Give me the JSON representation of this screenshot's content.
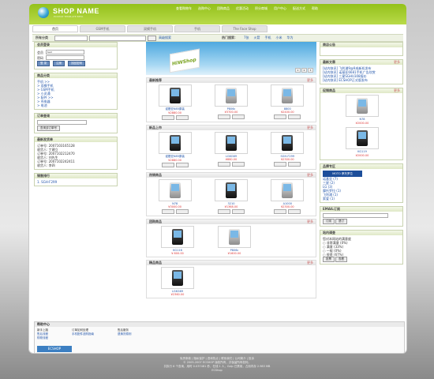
{
  "header": {
    "brand": "SHOP NAME",
    "tagline": "ECSHOP TEMPLATE BETA"
  },
  "topnav": [
    "查看购物车",
    "选购中心",
    "团购商品",
    "优惠活动",
    "积分商城",
    "用户中心",
    "配送方式",
    "帮助"
  ],
  "tabs": [
    "首页",
    "GSM手机",
    "双模手机",
    "手机",
    "The Face Shop"
  ],
  "searchbar": {
    "label": "所有分类",
    "button": "搜索",
    "advanced": "高级搜索",
    "hot_label": "热门搜索：",
    "hot_links": [
      "7张",
      "火箭",
      "手机",
      "小米",
      "华为"
    ]
  },
  "left": {
    "member": {
      "title": "会员登录",
      "user_label": "会员",
      "pass_label": "密码",
      "user_value": "test",
      "buttons": [
        "登 录",
        "注册",
        "找回密码"
      ]
    },
    "categories": {
      "title": "商品分类",
      "items": [
        "手机 >>",
        "> 双模手机",
        "> GSM手机",
        "> 小灵通",
        "> 配件 >>",
        "> 充电器",
        "> 电池"
      ]
    },
    "order": {
      "title": "订单查询",
      "button": "查询该订单号"
    },
    "invoice": {
      "title": "最新发货单",
      "rows": [
        "订单号: 2007103165128",
        "收货人: 丁建立",
        "订单号: 2007102212470",
        "收货人: 刘先生",
        "订单号: 2007102242411",
        "收货人: 李四"
      ]
    },
    "top10": {
      "title": "销售排行",
      "items": [
        "1. SGH-F299"
      ]
    }
  },
  "main": {
    "banner_text": "HiWShop",
    "banner_pages": [
      "1",
      "2",
      "3"
    ],
    "sections": [
      {
        "title": "最新推荐",
        "more": "更多",
        "products": [
          {
            "name": "诺基亚N85原装",
            "price": "¥2880.00"
          },
          {
            "name": "P806c",
            "price": "¥3700.00"
          },
          {
            "name": "8800",
            "price": "¥2400.00"
          }
        ]
      },
      {
        "title": "新品上市",
        "more": "更多",
        "products": [
          {
            "name": "诺基亚N85原装",
            "price": "¥2880.00"
          },
          {
            "name": "LGKG69",
            "price": "¥880.00"
          },
          {
            "name": "SGH-F299",
            "price": "¥2300.00"
          }
        ]
      },
      {
        "title": "热销商品",
        "more": "更多",
        "products": [
          {
            "name": "N78",
            "price": "¥3000.00"
          },
          {
            "name": "3210",
            "price": "¥1368.00"
          },
          {
            "name": "A1000",
            "price": "¥2300.00"
          }
        ]
      },
      {
        "title": "团购商品",
        "more": "更多",
        "products": [
          {
            "name": "KG116",
            "price": "¥ 800.00"
          },
          {
            "name": "P806c",
            "price": "¥1600.00"
          }
        ]
      },
      {
        "title": "精品商品",
        "more": "更多",
        "products": [
          {
            "name": "LGKG69",
            "price": "¥2360.00"
          }
        ]
      }
    ]
  },
  "right": {
    "notice": {
      "title": "商店公告"
    },
    "news": {
      "title": "最新文章",
      "more": "更多",
      "items": [
        "[站内快讯] 飞利浦9@9成新机发布",
        "[站内快讯] 诺基亚6681手机广告欣赏",
        "[站内快讯] 三星SGHU308报价",
        "[站内快讯] ECSHOP正式版发布"
      ]
    },
    "promo": {
      "title": "促销商品",
      "more": "更多",
      "products": [
        {
          "name": "N78",
          "price": "¥2000.00"
        },
        {
          "name": "KG119",
          "price": "¥2000.00"
        }
      ]
    },
    "brands": {
      "title": "品牌专区",
      "logo": "MOTO 摩托罗拉",
      "items": [
        "诺基亚 (7)",
        "三星 (2)",
        "LG (3)",
        "摩托罗拉 (1)",
        "飞利浦 (1)",
        "索爱 (1)"
      ]
    },
    "email": {
      "title": "EMAIL订阅",
      "buttons": [
        "订阅",
        "退订"
      ]
    },
    "vote": {
      "title": "站内调查",
      "question": "您对本网站的满意度",
      "options": [
        "非常满意 (0%)",
        "满意 (33%)",
        "一般 (0%)",
        "很差 (67%)"
      ],
      "buttons": [
        "投票",
        "查看"
      ]
    }
  },
  "footer": {
    "title": "帮助中心",
    "cols": [
      [
        "新手上路",
        "售后流程",
        "购物流程"
      ],
      [
        "订单如何处理",
        "手机配件选购指南"
      ],
      [
        "售后服务",
        "退换货原则"
      ]
    ],
    "logo": "ECSHOP"
  },
  "copyright": [
    "免责条款 | 隐私保护 | 咨询热点 | 联系我们 | 公司简介 | 投诉",
    "© 2005-2007 ECSHOP 版权所有，并保留所有权利。",
    "共执行 6 个查询，用时 0.037481 秒，在线 1 人，Gzip 已禁用，占用内存 2.983 MB",
    "ECShop"
  ]
}
